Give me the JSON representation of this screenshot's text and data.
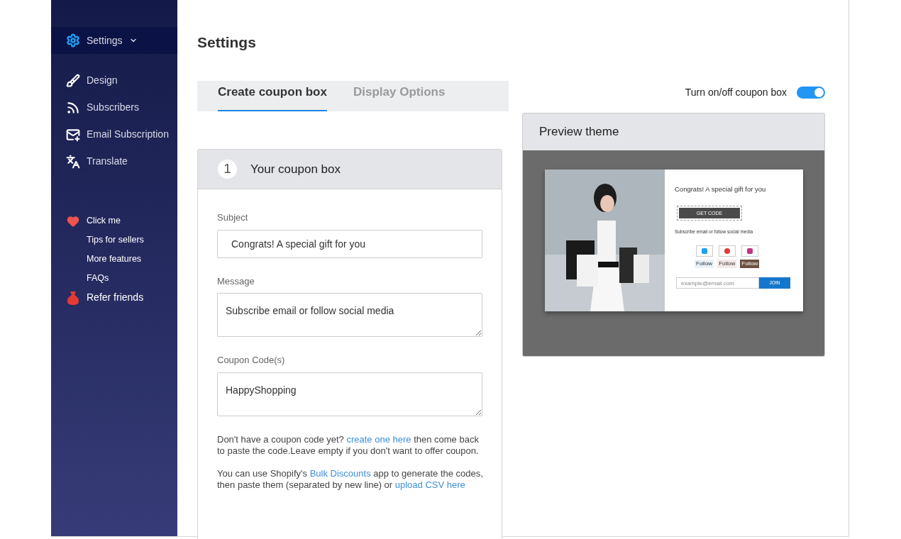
{
  "sidebar": {
    "header": {
      "label": "Settings",
      "expanded": false
    },
    "nav": [
      {
        "label": "Design"
      },
      {
        "label": "Subscribers"
      },
      {
        "label": "Email Subscription"
      },
      {
        "label": "Translate"
      }
    ],
    "extras": [
      {
        "label": "Click me"
      },
      {
        "label": "Tips for sellers"
      },
      {
        "label": "More features"
      },
      {
        "label": "FAQs"
      },
      {
        "label": "Refer friends"
      }
    ]
  },
  "page_title": "Settings",
  "tabs": [
    {
      "label": "Create coupon box",
      "selected": true
    },
    {
      "label": "Display Options",
      "selected": false
    }
  ],
  "toggle": {
    "label": "Turn on/off coupon box",
    "on": true
  },
  "section": {
    "number": "1",
    "title": "Your coupon box",
    "fields": [
      {
        "label": "Subject",
        "value": "Congrats! A special gift for you",
        "kind": "input"
      },
      {
        "label": "Message",
        "value": "Subscribe email or follow social media",
        "kind": "textarea"
      },
      {
        "label": "Coupon Code(s)",
        "value": "HappyShopping",
        "kind": "textarea"
      }
    ],
    "notes": [
      [
        {
          "text": "Don't have a coupon code yet? "
        },
        {
          "link": "create one here"
        },
        {
          "text": " then come back to paste the code.Leave empty if you don't want to offer coupon."
        }
      ],
      [
        {
          "text": "You can use Shopify's "
        },
        {
          "link": "Bulk Discounts"
        },
        {
          "text": " app to generate the codes, then paste them (separated by new line) or "
        },
        {
          "link": "upload CSV here"
        }
      ]
    ]
  },
  "preview": {
    "title": "Preview theme",
    "popup": {
      "heading": "Congrats! A special gift for you",
      "button": "GET CODE",
      "message": "Subscribe email or follow social media",
      "social": [
        {
          "label": "Follow"
        },
        {
          "label": "Follow"
        },
        {
          "label": "Follow"
        }
      ],
      "email_placeholder": "example@email.com",
      "join": "JOIN"
    }
  }
}
